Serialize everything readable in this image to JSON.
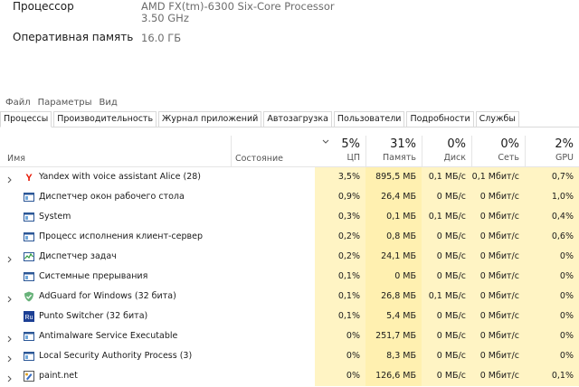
{
  "sysinfo": {
    "processor_label": "Процессор",
    "processor_value_1": "AMD FX(tm)-6300 Six-Core Processor",
    "processor_value_2": "3.50 GHz",
    "ram_label": "Оперативная память",
    "ram_value": "16.0 ГБ"
  },
  "menu": [
    "Файл",
    "Параметры",
    "Вид"
  ],
  "tabs": [
    "Процессы",
    "Производительность",
    "Журнал приложений",
    "Автозагрузка",
    "Пользователи",
    "Подробности",
    "Службы"
  ],
  "header": {
    "name": "Имя",
    "status": "Состояние",
    "cpu_pct": "5%",
    "cpu_label": "ЦП",
    "mem_pct": "31%",
    "mem_label": "Память",
    "disk_pct": "0%",
    "disk_label": "Диск",
    "net_pct": "0%",
    "net_label": "Сеть",
    "gpu_pct": "2%",
    "gpu_label": "GPU"
  },
  "processes": [
    {
      "name": "Yandex with voice assistant Alice (28)",
      "icon": "yandex-icon",
      "expandable": true,
      "cpu": "3,5%",
      "mem": "895,5 МБ",
      "disk": "0,1 МБ/с",
      "net": "0,1 Мбит/с",
      "gpu": "0,7%"
    },
    {
      "name": "Диспетчер окон рабочего стола",
      "icon": "window-icon",
      "expandable": false,
      "cpu": "0,9%",
      "mem": "26,4 МБ",
      "disk": "0 МБ/с",
      "net": "0 Мбит/с",
      "gpu": "1,0%"
    },
    {
      "name": "System",
      "icon": "window-icon",
      "expandable": false,
      "cpu": "0,3%",
      "mem": "0,1 МБ",
      "disk": "0,1 МБ/с",
      "net": "0 Мбит/с",
      "gpu": "0,4%"
    },
    {
      "name": "Процесс исполнения клиент-сервер",
      "icon": "window-icon",
      "expandable": false,
      "cpu": "0,2%",
      "mem": "0,8 МБ",
      "disk": "0 МБ/с",
      "net": "0 Мбит/с",
      "gpu": "0,6%"
    },
    {
      "name": "Диспетчер задач",
      "icon": "task-manager-icon",
      "expandable": true,
      "cpu": "0,2%",
      "mem": "24,1 МБ",
      "disk": "0 МБ/с",
      "net": "0 Мбит/с",
      "gpu": "0%"
    },
    {
      "name": "Системные прерывания",
      "icon": "window-icon",
      "expandable": false,
      "cpu": "0,1%",
      "mem": "0 МБ",
      "disk": "0 МБ/с",
      "net": "0 Мбит/с",
      "gpu": "0%"
    },
    {
      "name": "AdGuard for Windows (32 бита)",
      "icon": "adguard-icon",
      "expandable": true,
      "cpu": "0,1%",
      "mem": "26,8 МБ",
      "disk": "0,1 МБ/с",
      "net": "0 Мбит/с",
      "gpu": "0%"
    },
    {
      "name": "Punto Switcher (32 бита)",
      "icon": "punto-icon",
      "expandable": false,
      "cpu": "0,1%",
      "mem": "5,4 МБ",
      "disk": "0 МБ/с",
      "net": "0 Мбит/с",
      "gpu": "0%"
    },
    {
      "name": "Antimalware Service Executable",
      "icon": "window-icon",
      "expandable": true,
      "cpu": "0%",
      "mem": "251,7 МБ",
      "disk": "0 МБ/с",
      "net": "0 Мбит/с",
      "gpu": "0%"
    },
    {
      "name": "Local Security Authority Process (3)",
      "icon": "window-icon",
      "expandable": true,
      "cpu": "0%",
      "mem": "8,3 МБ",
      "disk": "0 МБ/с",
      "net": "0 Мбит/с",
      "gpu": "0%"
    },
    {
      "name": "paint.net",
      "icon": "paintnet-icon",
      "expandable": true,
      "cpu": "0%",
      "mem": "126,6 МБ",
      "disk": "0 МБ/с",
      "net": "0 Мбит/с",
      "gpu": "0,1%"
    }
  ]
}
